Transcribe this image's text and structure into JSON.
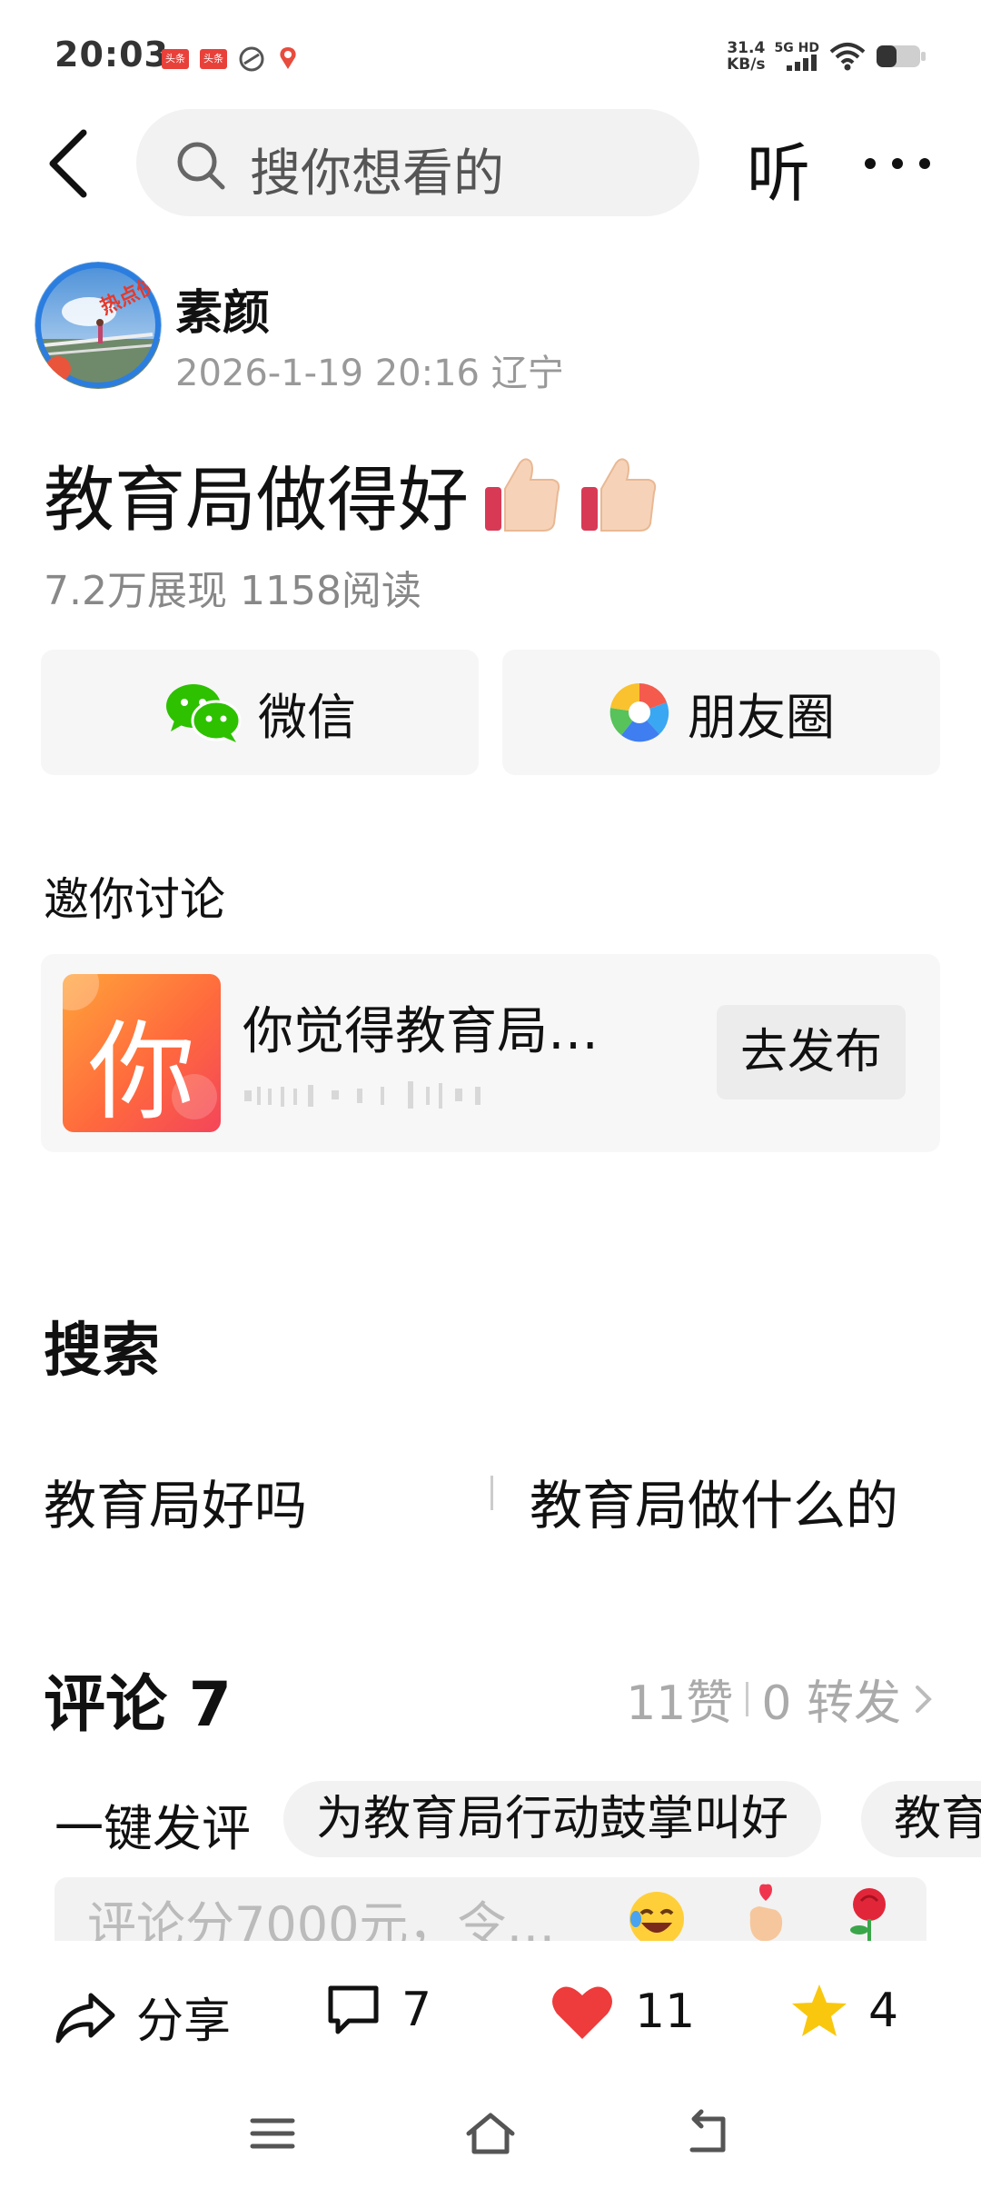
{
  "status_bar": {
    "time": "20:03",
    "net_speed_value": "31.4",
    "net_speed_unit": "KB/s",
    "signal_label": "5G HD",
    "notif_badge_1": "头条",
    "notif_badge_2": "头条"
  },
  "header": {
    "search_placeholder": "搜你想看的",
    "listen_label": "听"
  },
  "author": {
    "name": "素颜",
    "meta": "2026-1-19 20:16 辽宁",
    "avatar_badge": "热点侠"
  },
  "post": {
    "title": "教育局做得好",
    "stats": "7.2万展现  1158阅读"
  },
  "share": {
    "wechat_label": "微信",
    "moments_label": "朋友圈"
  },
  "invite": {
    "title": "邀你讨论",
    "icon_char": "你",
    "question": "你觉得教育局…",
    "publish_label": "去发布"
  },
  "search_section": {
    "title": "搜索",
    "suggestions": [
      "教育局好吗",
      "教育局做什么的"
    ]
  },
  "comments": {
    "title": "评论 7",
    "likes": "11赞",
    "reposts": "0 转发",
    "one_click_label": "一键发评",
    "chips": [
      "为教育局行动鼓掌叫好",
      "教育"
    ],
    "input_placeholder": "评论分7000元，令…"
  },
  "action_bar": {
    "share_label": "分享",
    "comment_count": "7",
    "like_count": "11",
    "favorite_count": "4"
  },
  "colors": {
    "accent_red": "#ee3b3b",
    "star_yellow": "#f9c80e",
    "wechat_green": "#2dc100"
  }
}
